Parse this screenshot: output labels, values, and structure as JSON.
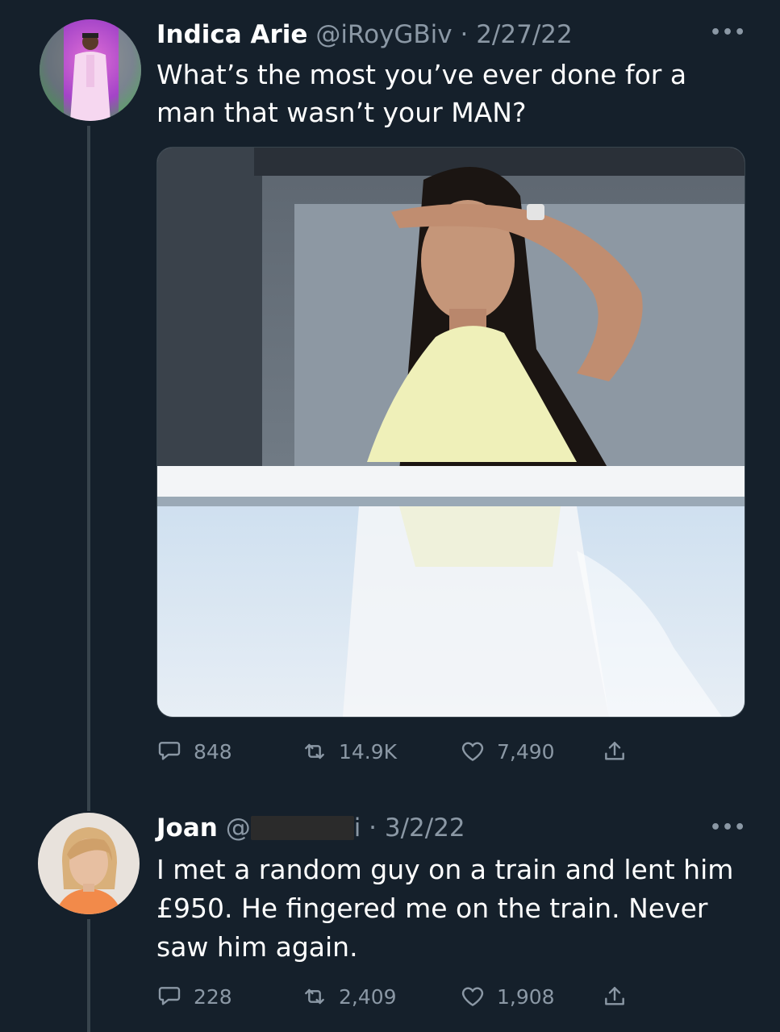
{
  "tweet": {
    "author_name": "Indica Arie",
    "author_handle": "@iRoyGBiv",
    "date": "2/27/22",
    "text_line1": "What’s the most you’ve ever done for a",
    "text_line2": "man that wasn’t your MAN?",
    "more_icon": "ellipsis-icon",
    "stats": {
      "replies": "848",
      "retweets": "14.9K",
      "likes": "7,490"
    }
  },
  "reply": {
    "author_name": "Joan",
    "author_handle_start": "@",
    "author_handle_end": "i",
    "date": "3/2/22",
    "text_line1": "I met a random guy on a train and lent him",
    "text_line2": "£950. He fingered me on the train. Never",
    "text_line3": "saw him again.",
    "more_icon": "ellipsis-icon",
    "stats": {
      "replies": "228",
      "retweets": "2,409",
      "likes": "1,908"
    }
  },
  "separator": " · ",
  "more_glyph": "•••",
  "colors": {
    "background": "#15202b",
    "secondary_text": "#8b98a5",
    "thread_line": "#38444d"
  }
}
